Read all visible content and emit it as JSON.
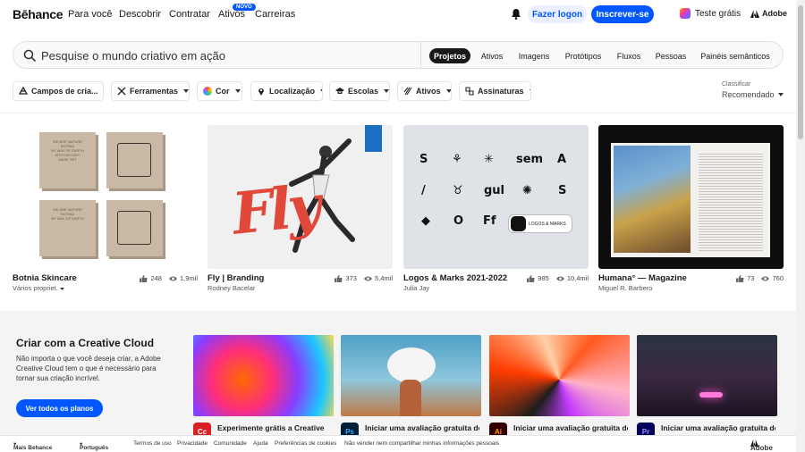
{
  "brand": {
    "logo": "Bēhance"
  },
  "nav": {
    "links": [
      "Para você",
      "Descobrir",
      "Contratar",
      "Ativos",
      "Carreiras"
    ],
    "new_badge": "NOVO",
    "login": "Fazer logon",
    "signup": "Inscrever-se",
    "trial": "Teste grátis",
    "adobe": "Adobe"
  },
  "search": {
    "placeholder": "Pesquise o mundo criativo em ação",
    "tabs": [
      "Projetos",
      "Ativos",
      "Imagens",
      "Protótipos",
      "Fluxos",
      "Pessoas",
      "Painéis semânticos"
    ],
    "active_tab": "Projetos"
  },
  "filters": {
    "items": [
      "Campos de cria...",
      "Ferramentas",
      "Cor",
      "Localização",
      "Escolas",
      "Ativos",
      "Assinaturas"
    ],
    "sort_label": "Classificar",
    "sort_value": "Recomendado"
  },
  "projects": [
    {
      "title": "Botnia Skincare",
      "owner": "Vários propriet.",
      "likes": "248",
      "views": "1,9mil",
      "box_text": [
        "WE ARE NATURE",
        "BOTNIA",
        "BY WAY OF EARTH",
        "APOTHECARY",
        "MASK SET"
      ]
    },
    {
      "title": "Fly | Branding",
      "owner": "Rodney Bacelar",
      "likes": "373",
      "views": "5,4mil",
      "hero_word": "Fly"
    },
    {
      "title": "Logos & Marks 2021-2022",
      "owner": "Julia Jay",
      "likes": "985",
      "views": "10,4mil",
      "glyphs": [
        "S",
        "⚘",
        "✳",
        "sem",
        "A",
        "/",
        "♉",
        "gul",
        "✺",
        "S",
        "◆",
        "O",
        "Ff"
      ],
      "inner_card": "LOGOS & MARKS"
    },
    {
      "title": "Humana° — Magazine",
      "owner": "Miguel R. Barbero",
      "likes": "73",
      "views": "760"
    }
  ],
  "creative_cloud": {
    "title": "Criar com a Creative Cloud",
    "description": "Não importa o que você deseja criar, a Adobe Creative Cloud tem o que é necessário para tornar sua criação incrível.",
    "button": "Ver todos os planos",
    "apps": [
      {
        "label": "Experimente grátis a Creative",
        "icon": "Cc",
        "color": "#da1f26"
      },
      {
        "label": "Iniciar uma avaliação gratuita de",
        "icon": "Ps",
        "color": "#001e36"
      },
      {
        "label": "Iniciar uma avaliação gratuita de",
        "icon": "Ai",
        "color": "#330000"
      },
      {
        "label": "Iniciar uma avaliação gratuita de",
        "icon": "Pr",
        "color": "#00005b"
      }
    ]
  },
  "footer": {
    "more": "Mais Behance",
    "language": "Português",
    "links": [
      "Termos de uso",
      "Privacidade",
      "Comunidade",
      "Ajuda",
      "Preferências de cookies",
      "Não vender nem compartilhar minhas informações pessoais"
    ],
    "adobe": "Adobe"
  },
  "colors": {
    "accent": "#0057ff",
    "text": "#191919",
    "section_bg": "#f4f4f4"
  }
}
